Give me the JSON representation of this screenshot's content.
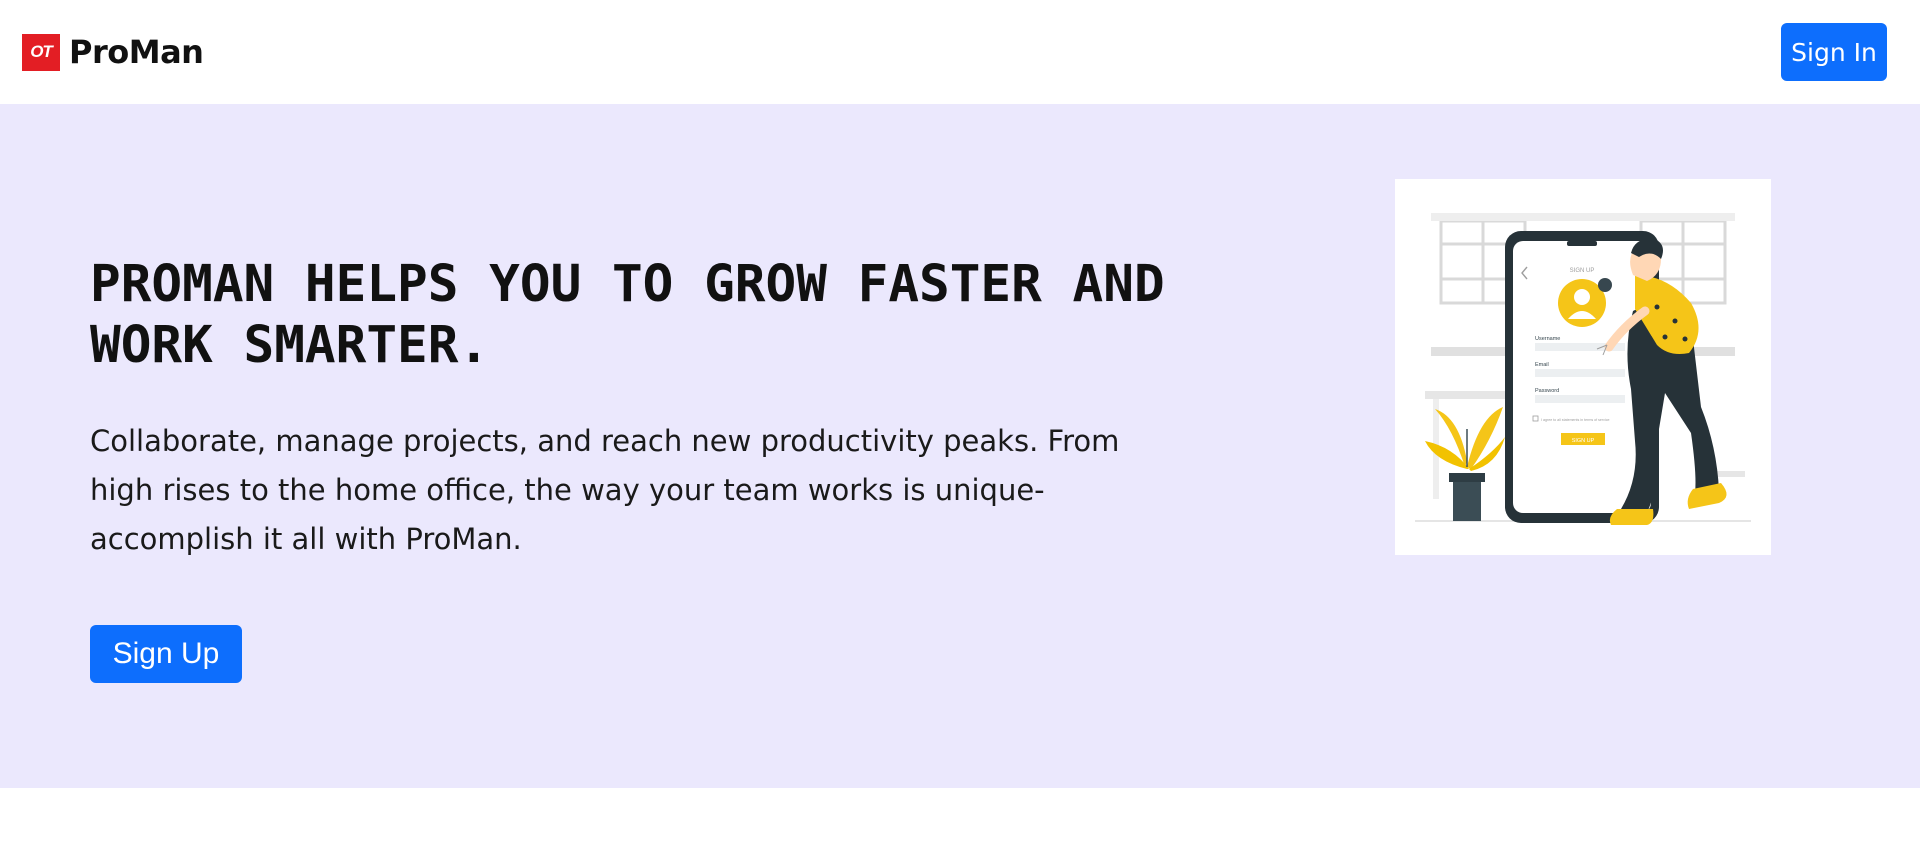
{
  "navbar": {
    "logo_text": "OT",
    "brand_name": "ProMan",
    "signin_label": "Sign In",
    "accent_color": "#0d6efd",
    "logo_color": "#e31e24"
  },
  "hero": {
    "background_color": "#ebe8fd",
    "title": "PROMAN HELPS YOU TO GROW FASTER AND WORK SMARTER.",
    "text": "Collaborate, manage projects, and reach new productivity peaks. From high rises to the home office, the way your team works is unique-accomplish it all with ProMan.",
    "signup_label": "Sign Up",
    "illustration": {
      "header": "SIGN UP",
      "username_label": "Username",
      "email_label": "Email",
      "password_label": "Password",
      "terms_text": "I agree to all statements in terms of service",
      "button_label": "SIGN UP",
      "accent_color": "#f5c518"
    }
  }
}
